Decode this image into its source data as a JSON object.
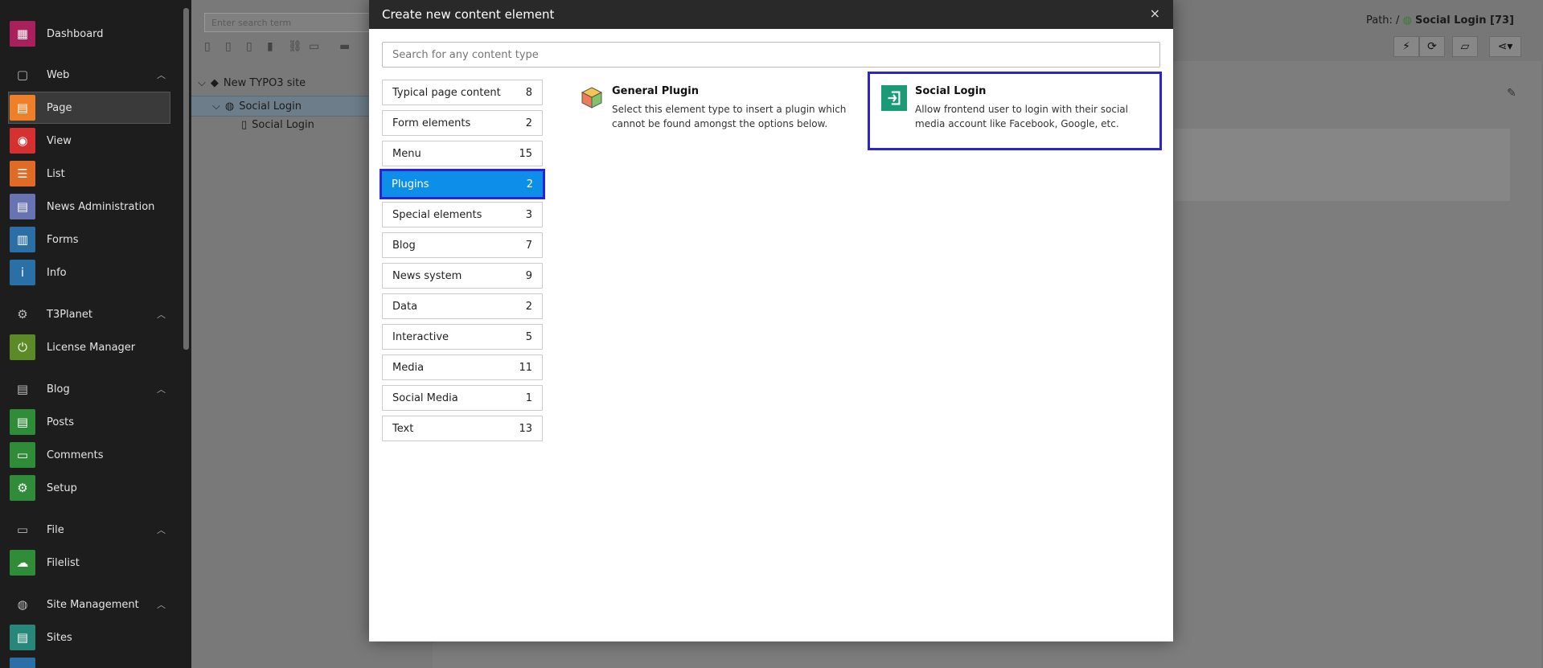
{
  "sidebar": {
    "items": [
      {
        "label": "Dashboard",
        "icon": "dashboard-icon",
        "color": "#a8215a"
      },
      {
        "label": "Page",
        "icon": "page-icon",
        "color": "#f07f2a"
      },
      {
        "label": "View",
        "icon": "eye-icon",
        "color": "#d63030"
      },
      {
        "label": "List",
        "icon": "list-icon",
        "color": "#df6b27"
      },
      {
        "label": "News Administration",
        "icon": "news-icon",
        "color": "#6873b2"
      },
      {
        "label": "Forms",
        "icon": "forms-icon",
        "color": "#2c6fa6"
      },
      {
        "label": "Info",
        "icon": "info-icon",
        "color": "#2a6fa6"
      },
      {
        "label": "License Manager",
        "icon": "power-icon",
        "color": "#5b8a26"
      },
      {
        "label": "Posts",
        "icon": "posts-icon",
        "color": "#2f8d3a"
      },
      {
        "label": "Comments",
        "icon": "comments-icon",
        "color": "#2f8d3a"
      },
      {
        "label": "Setup",
        "icon": "setup-gear-icon",
        "color": "#2f8d3a"
      },
      {
        "label": "Filelist",
        "icon": "cloud-icon",
        "color": "#2f8d3a"
      },
      {
        "label": "Sites",
        "icon": "sites-icon",
        "color": "#26877a"
      }
    ],
    "groups": [
      "Web",
      "T3Planet",
      "Blog",
      "File",
      "Site Management"
    ]
  },
  "tree": {
    "search_placeholder": "Enter search term",
    "root": "New TYPO3 site",
    "node": "Social Login",
    "child": "Social Login"
  },
  "header": {
    "path_label": "Path: /",
    "path_page": "Social Login [73]"
  },
  "modal": {
    "title": "Create new content element",
    "close": "×",
    "search_placeholder": "Search for any content type",
    "categories": [
      {
        "label": "Typical page content",
        "count": "8"
      },
      {
        "label": "Form elements",
        "count": "2"
      },
      {
        "label": "Menu",
        "count": "15"
      },
      {
        "label": "Plugins",
        "count": "2"
      },
      {
        "label": "Special elements",
        "count": "3"
      },
      {
        "label": "Blog",
        "count": "7"
      },
      {
        "label": "News system",
        "count": "9"
      },
      {
        "label": "Data",
        "count": "2"
      },
      {
        "label": "Interactive",
        "count": "5"
      },
      {
        "label": "Media",
        "count": "11"
      },
      {
        "label": "Social Media",
        "count": "1"
      },
      {
        "label": "Text",
        "count": "13"
      }
    ],
    "selected_category": "Plugins",
    "elements": [
      {
        "title": "General Plugin",
        "desc": "Select this element type to insert a plugin which cannot be found amongst the options below.",
        "icon": "plugin-box-icon"
      },
      {
        "title": "Social Login",
        "desc": "Allow frontend user to login with their social media account like Facebook, Google, etc.",
        "icon": "login-icon"
      }
    ]
  },
  "colors": {
    "accent": "#0d8ee9",
    "highlight": "#2c25ce",
    "login_icon": "#1a9b78"
  }
}
